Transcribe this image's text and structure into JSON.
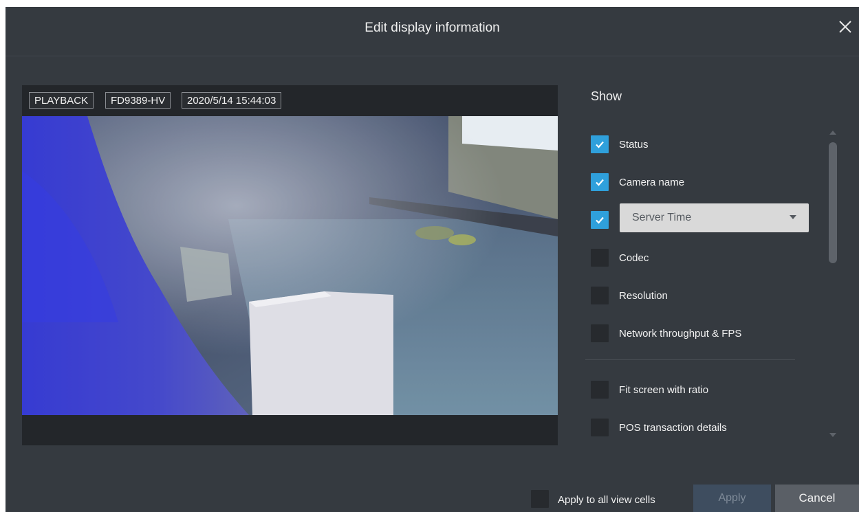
{
  "dialog": {
    "title": "Edit display information",
    "close_icon": "close-icon"
  },
  "preview": {
    "osd": {
      "status": "PLAYBACK",
      "camera_name": "FD9389-HV",
      "timestamp": "2020/5/14 15:44:03"
    }
  },
  "show": {
    "title": "Show",
    "options": [
      {
        "label": "Status",
        "checked": true
      },
      {
        "label": "Camera name",
        "checked": true
      },
      {
        "label": "",
        "checked": true
      },
      {
        "label": "Codec",
        "checked": false
      },
      {
        "label": "Resolution",
        "checked": false
      },
      {
        "label": "Network throughput & FPS",
        "checked": false
      },
      {
        "label": "Fit screen with ratio",
        "checked": false
      },
      {
        "label": "POS transaction details",
        "checked": false
      }
    ],
    "time_select": {
      "value": "Server Time"
    }
  },
  "footer": {
    "apply_all_label": "Apply to all view cells",
    "apply_all_checked": false,
    "apply_label": "Apply",
    "cancel_label": "Cancel"
  },
  "colors": {
    "dialog_bg": "#353a40",
    "accent": "#2fa0dc",
    "checkbox_off": "#272a2e"
  }
}
